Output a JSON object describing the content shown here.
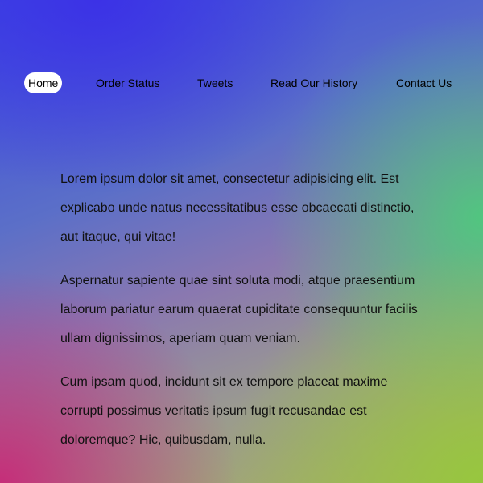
{
  "nav": {
    "items": [
      {
        "label": "Home",
        "active": true
      },
      {
        "label": "Order Status",
        "active": false
      },
      {
        "label": "Tweets",
        "active": false
      },
      {
        "label": "Read Our History",
        "active": false
      },
      {
        "label": "Contact Us",
        "active": false
      }
    ]
  },
  "main": {
    "paragraphs": [
      "Lorem ipsum dolor sit amet, consectetur adipisicing elit. Est explicabo unde natus necessitatibus esse obcaecati distinctio, aut itaque, qui vitae!",
      "Aspernatur sapiente quae sint soluta modi, atque praesentium laborum pariatur earum quaerat cupiditate consequuntur facilis ullam dignissimos, aperiam quam veniam.",
      "Cum ipsam quod, incidunt sit ex tempore placeat maxime corrupti possimus veritatis ipsum fugit recusandae est doloremque? Hic, quibusdam, nulla."
    ]
  },
  "colors": {
    "background_top": "#3a3fe0",
    "background_right": "#5ccf78",
    "background_bottom_left": "#c8307a",
    "background_bottom_right": "#a0b84a",
    "active_nav_bg": "#ffffff",
    "text": "#111111"
  }
}
